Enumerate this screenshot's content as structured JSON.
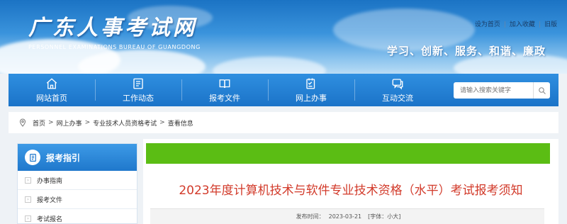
{
  "header": {
    "site_title": "广东人事考试网",
    "site_subtitle": "PERSONNEL EXAMINATIONS BUREAU OF GUANGDONG",
    "links": [
      "设为首页",
      "加入收藏",
      "旧版"
    ],
    "slogan": "学习、创新、服务、和谐、廉政"
  },
  "nav": {
    "items": [
      {
        "label": "网站首页",
        "icon": "home-icon"
      },
      {
        "label": "工作动态",
        "icon": "news-icon"
      },
      {
        "label": "报考文件",
        "icon": "book-icon"
      },
      {
        "label": "网上办事",
        "icon": "checklist-icon"
      },
      {
        "label": "互动交流",
        "icon": "chat-icon"
      }
    ],
    "search_placeholder": "请输入搜索关键字"
  },
  "breadcrumb": [
    "首页",
    "网上办事",
    "专业技术人员资格考试",
    "查看信息"
  ],
  "sidebar": {
    "title": "报考指引",
    "items": [
      "办事指南",
      "报考文件",
      "考试报名"
    ]
  },
  "article": {
    "title": "2023年度计算机技术与软件专业技术资格（水平）考试报考须知",
    "publish_label": "发布时间：",
    "publish_date": "2023-03-21",
    "font_size_label": "[字体：小大]"
  },
  "colors": {
    "nav_blue": "#1b73c8",
    "title_red": "#d23a2a",
    "green_bar": "#5bbd14"
  }
}
